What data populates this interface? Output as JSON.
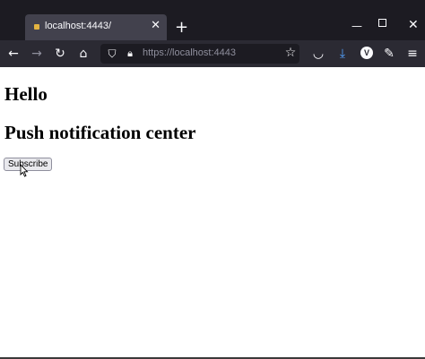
{
  "tab": {
    "title": "localhost:4443/",
    "close_icon": "close-icon"
  },
  "toolbar": {
    "url_host": "https://localhost",
    "url_port": ":4443",
    "account_letter": "V"
  },
  "page": {
    "heading1": "Hello",
    "heading2": "Push notification center",
    "subscribe_label": "Subscribe"
  },
  "colors": {
    "chrome_dark": "#1c1b22",
    "toolbar": "#2b2a33",
    "tab_active": "#42414d",
    "download_accent": "#54a3ff"
  }
}
